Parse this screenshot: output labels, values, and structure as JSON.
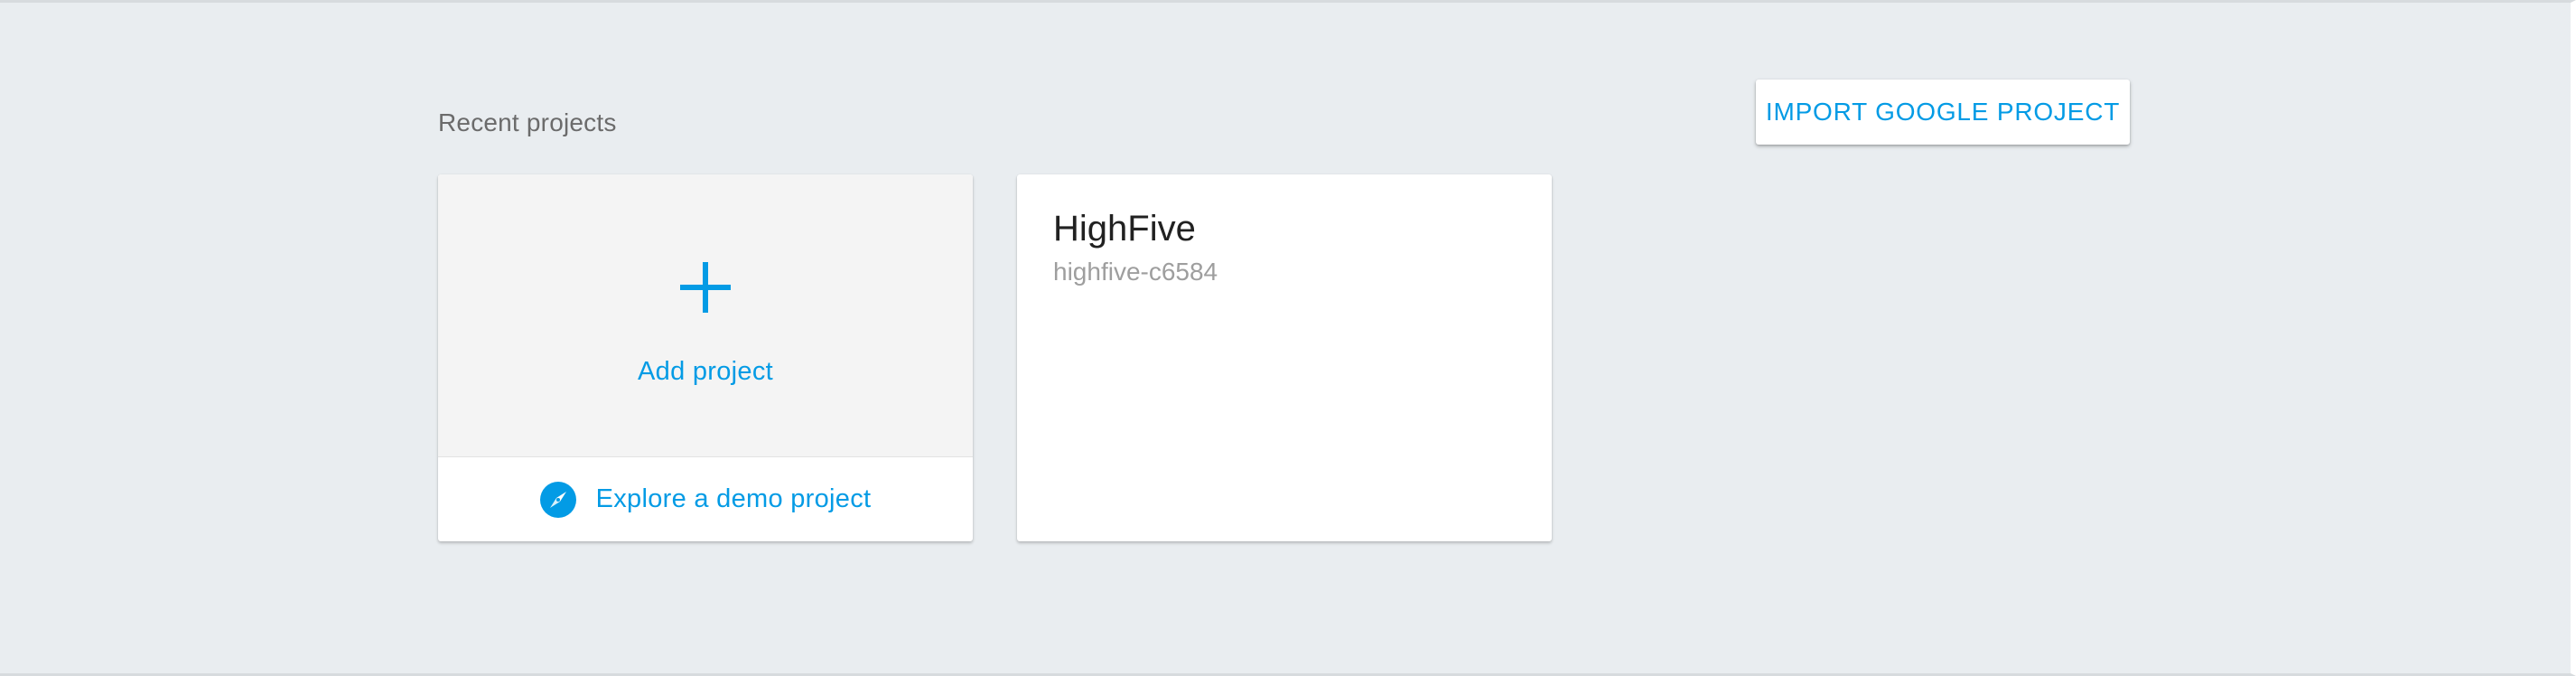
{
  "header": {
    "recent_label": "Recent projects",
    "import_button_label": "IMPORT GOOGLE PROJECT"
  },
  "add_card": {
    "icon": "plus-icon",
    "label": "Add project",
    "demo_icon": "compass-icon",
    "demo_label": "Explore a demo project"
  },
  "projects": [
    {
      "name": "HighFive",
      "id": "highfive-c6584"
    }
  ],
  "colors": {
    "accent": "#039be5",
    "background": "#e9edf0",
    "card": "#ffffff",
    "add_area": "#f4f4f4"
  }
}
